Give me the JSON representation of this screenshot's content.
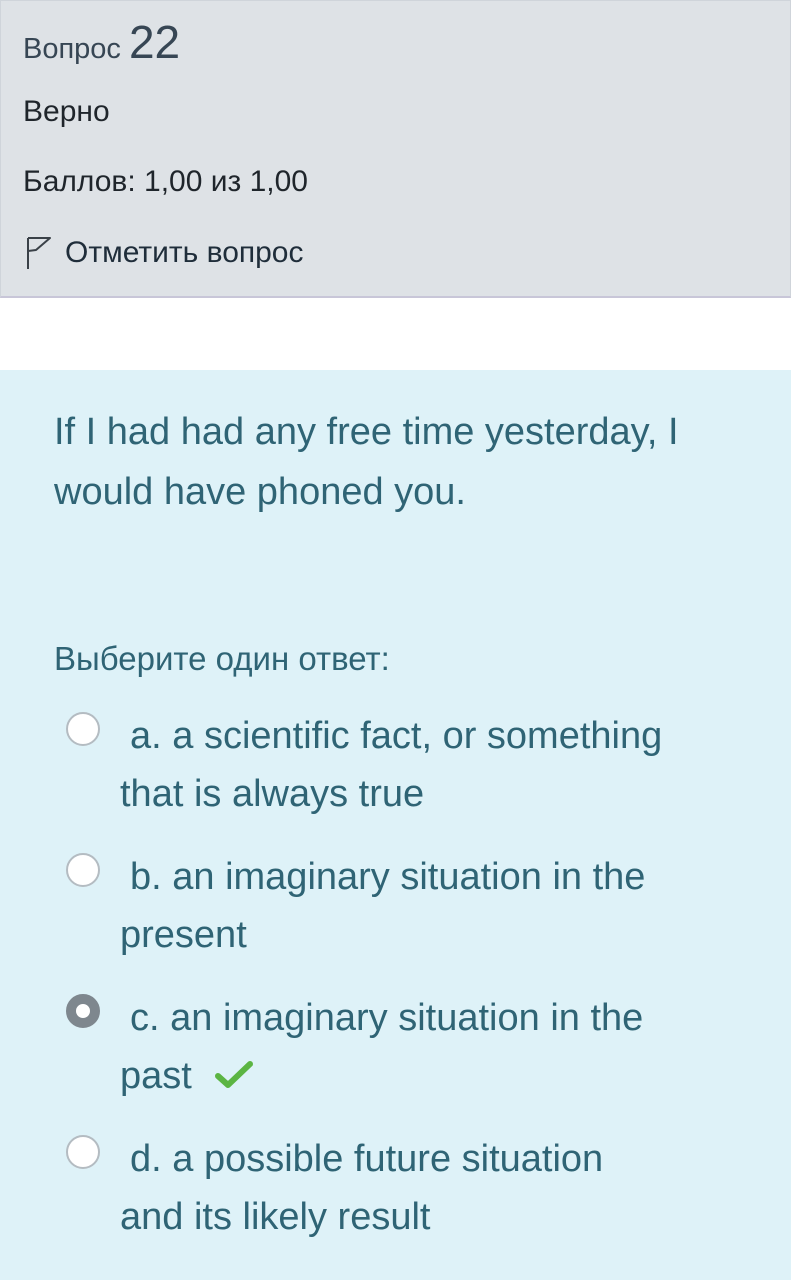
{
  "question": {
    "label": "Вопрос",
    "number": "22",
    "state": "Верно",
    "grade": "Баллов: 1,00 из 1,00",
    "flag_label": "Отметить вопрос"
  },
  "content": {
    "text": "If I had had any free time yesterday, I would have phoned you.",
    "prompt": "Выберите один ответ:",
    "options": [
      {
        "line1": "a. a scientific fact, or something",
        "line2": "that is always true",
        "selected": false
      },
      {
        "line1": "b. an imaginary situation in the",
        "line2": "present",
        "selected": false
      },
      {
        "line1": "c. an imaginary situation in the",
        "line2": "past",
        "selected": true,
        "correct": true
      },
      {
        "line1": "d. a possible future situation",
        "line2": "and its likely result",
        "selected": false
      }
    ]
  },
  "icons": {
    "flag": "flag-outline-icon",
    "correct": "checkmark-icon"
  },
  "colors": {
    "info_bg": "#dee2e6",
    "content_bg": "#def2f8",
    "text_teal": "#2f6475",
    "check_green": "#5bb543"
  }
}
